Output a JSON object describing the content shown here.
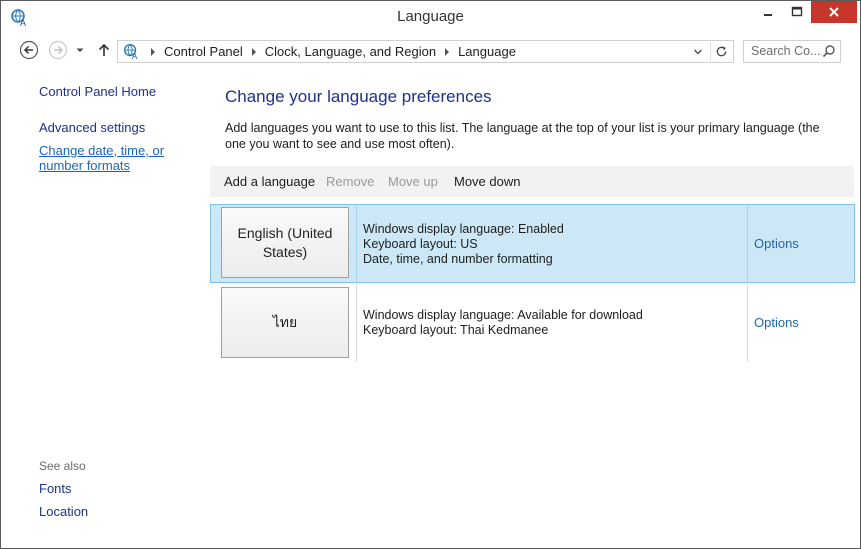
{
  "window": {
    "title": "Language",
    "close_color": "#c7352b"
  },
  "address_bar": {
    "crumbs": [
      "Control Panel",
      "Clock, Language, and Region",
      "Language"
    ]
  },
  "search": {
    "placeholder": "Search Co..."
  },
  "left_pane": {
    "home": "Control Panel Home",
    "advanced": "Advanced settings",
    "date_formats": "Change date, time, or number formats",
    "see_also": "See also",
    "fonts": "Fonts",
    "location": "Location"
  },
  "main": {
    "heading": "Change your language preferences",
    "description": "Add languages you want to use to this list. The language at the top of your list is your primary language (the one you want to see and use most often).",
    "toolbar": {
      "add": "Add a language",
      "remove": "Remove",
      "move_up": "Move up",
      "move_down": "Move down"
    },
    "languages": [
      {
        "name": "English (United States)",
        "lines": [
          "Windows display language: Enabled",
          "Keyboard layout: US",
          "Date, time, and number formatting"
        ],
        "options": "Options",
        "selected": true
      },
      {
        "name": "ไทย",
        "lines": [
          "Windows display language: Available for download",
          "Keyboard layout: Thai Kedmanee"
        ],
        "options": "Options",
        "selected": false
      }
    ]
  },
  "colors": {
    "link": "#1e3287",
    "selection": "#cce8f6",
    "selection_border": "#7fc4e8"
  }
}
